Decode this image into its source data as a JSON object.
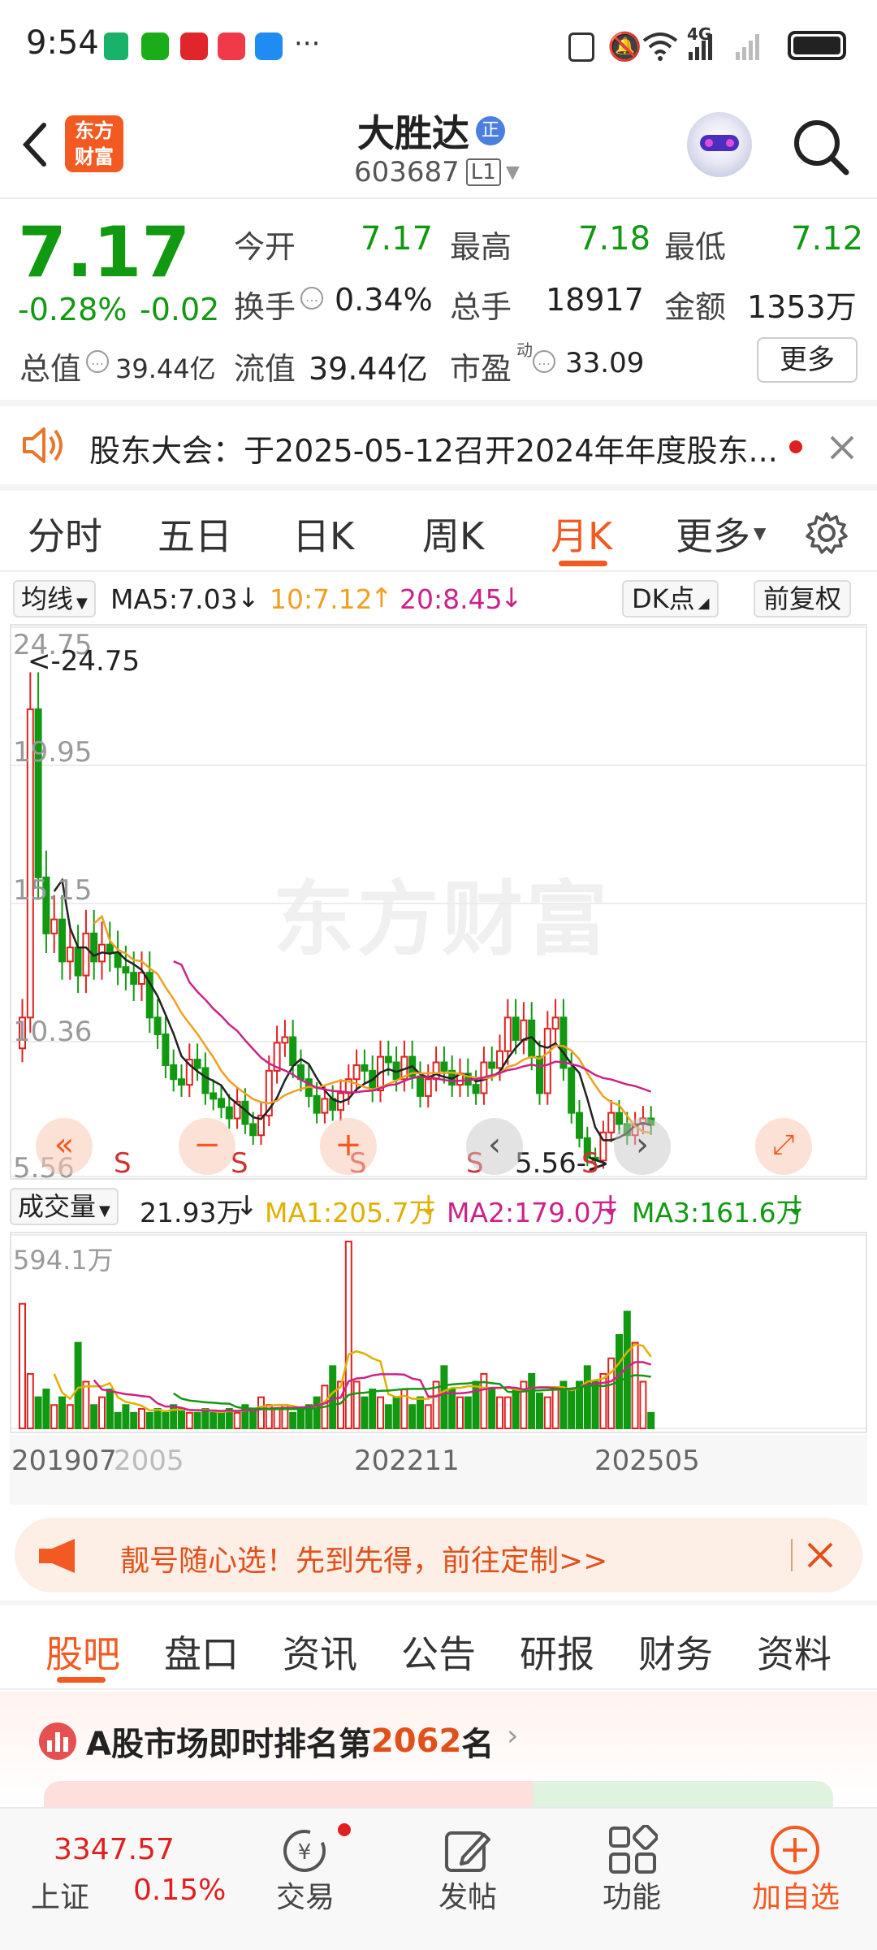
{
  "status_bar": {
    "time": "9:54",
    "more": "···",
    "network": "4G"
  },
  "header": {
    "app_logo_text": [
      "东方",
      "财富"
    ],
    "stock_name": "大胜达",
    "badge": "正",
    "stock_code": "603687",
    "level": "L1"
  },
  "quote": {
    "price": "7.17",
    "change_pct": "-0.28%",
    "change": "-0.02",
    "open_label": "今开",
    "open": "7.17",
    "high_label": "最高",
    "high": "7.18",
    "low_label": "最低",
    "low": "7.12",
    "turnover_label": "换手",
    "turnover": "0.34%",
    "volume_label": "总手",
    "volume": "18917",
    "amount_label": "金额",
    "amount": "1353万",
    "total_value_label": "总值",
    "total_value": "39.44亿",
    "float_value_label": "流值",
    "float_value": "39.44亿",
    "pe_label": "市盈",
    "pe_sup": "动",
    "pe": "33.09",
    "more_button": "更多"
  },
  "notice": {
    "text": "股东大会：于2025-05-12召开2024年年度股东..."
  },
  "period_tabs": {
    "tabs": [
      "分时",
      "五日",
      "日K",
      "周K",
      "月K",
      "更多"
    ],
    "active": "月K"
  },
  "ma_bar": {
    "indicator": "均线",
    "ma5": "MA5:7.03",
    "ma10": "10:7.12",
    "ma20": "20:8.45",
    "dk_button": "DK点",
    "adjust_button": "前复权"
  },
  "kline": {
    "y_labels": [
      "24.75",
      "19.95",
      "15.15",
      "10.36",
      "5.56"
    ],
    "max_label": "<-24.75",
    "min_label": "5.56->",
    "signal": "S",
    "watermark": "东方财富"
  },
  "volume_bar": {
    "indicator": "成交量",
    "vol": "21.93万",
    "ma1": "MA1:205.7万",
    "ma2": "MA2:179.0万",
    "ma3": "MA3:161.6万",
    "max": "594.1万"
  },
  "x_axis": {
    "labels": [
      "201907",
      "2005",
      "202211",
      "202505"
    ]
  },
  "promo": {
    "text": "靓号随心选！先到先得，前往定制>>"
  },
  "sub_tabs": {
    "tabs": [
      "股吧",
      "盘口",
      "资讯",
      "公告",
      "研报",
      "财务",
      "资料"
    ],
    "active": "股吧"
  },
  "ranking": {
    "prefix": "A股市场即时排名第",
    "rank": "2062",
    "suffix": "名"
  },
  "bottom_nav": {
    "index_value": "3347.57",
    "index_name": "上证",
    "index_change": "0.15%",
    "items": [
      "交易",
      "发帖",
      "功能",
      "加自选"
    ]
  },
  "colors": {
    "up": "#e02020",
    "down": "#119911",
    "accent": "#ff6a00",
    "ma5": "#222222",
    "ma10": "#f0a020",
    "ma20": "#cc2288"
  }
}
